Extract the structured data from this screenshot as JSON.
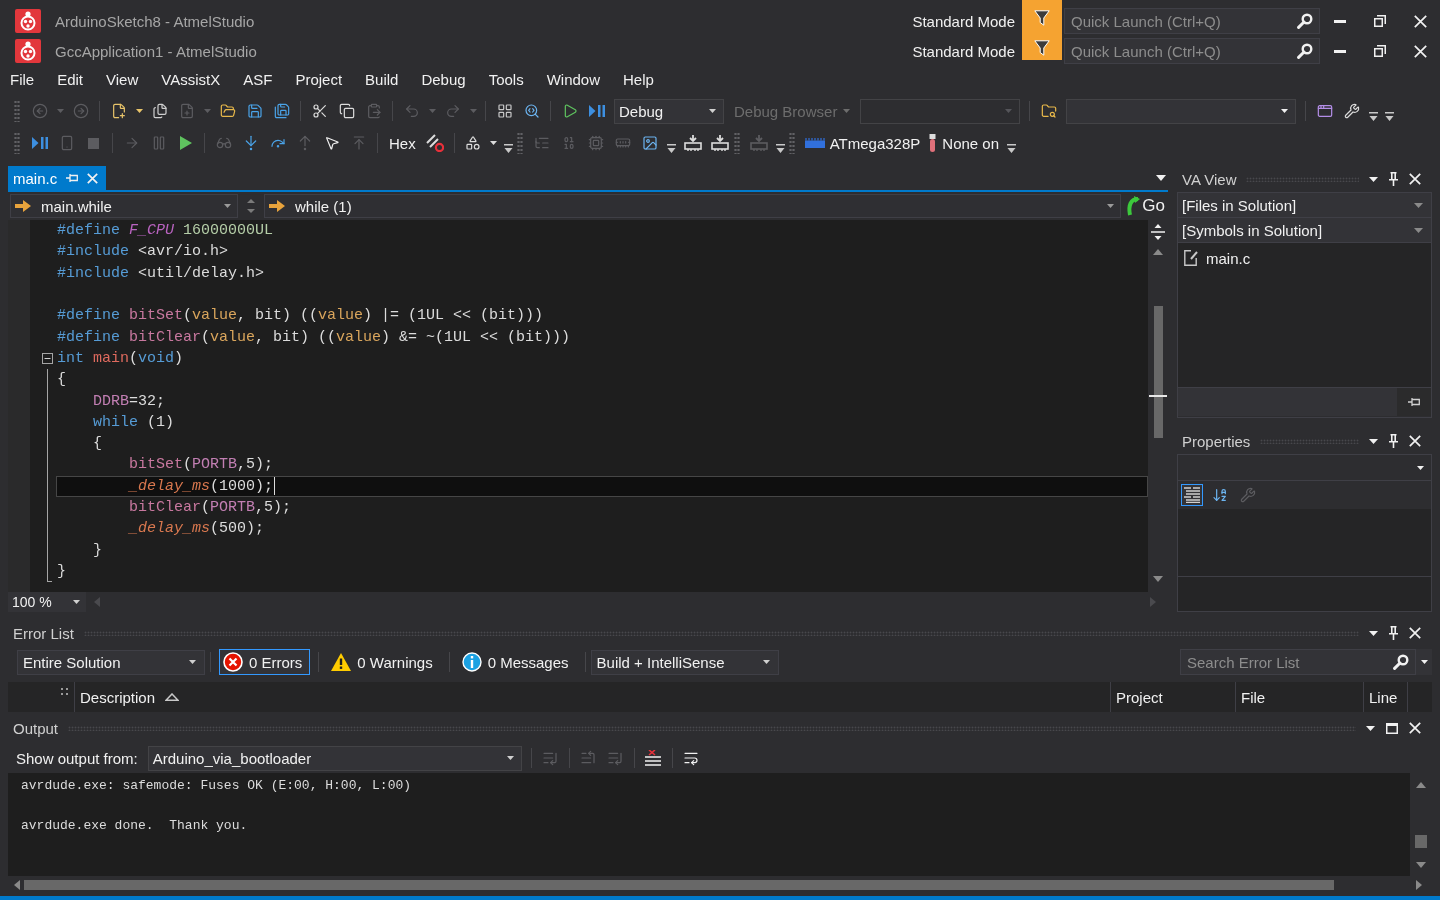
{
  "windows": [
    {
      "title": "ArduinoSketch8 - AtmelStudio",
      "mode": "Standard Mode",
      "quick_launch": {
        "placeholder": "Quick Launch (Ctrl+Q)"
      }
    },
    {
      "title": "GccApplication1 - AtmelStudio",
      "mode": "Standard Mode",
      "quick_launch": {
        "placeholder": "Quick Launch (Ctrl+Q)"
      }
    }
  ],
  "menu": [
    "File",
    "Edit",
    "View",
    "VAssistX",
    "ASF",
    "Project",
    "Build",
    "Debug",
    "Tools",
    "Window",
    "Help"
  ],
  "toolbar_1": {
    "buttons": [
      {
        "disabled": true
      },
      {
        "disabled": true
      },
      {
        "disabled": false
      },
      {
        "disabled": false
      },
      {
        "disabled": true
      },
      {
        "disabled": false
      },
      {
        "disabled": false
      },
      {
        "disabled": false
      },
      {
        "disabled": false
      },
      {
        "disabled": false
      },
      {
        "disabled": true
      },
      {
        "disabled": true
      },
      {
        "disabled": true
      },
      {
        "disabled": false
      },
      {
        "disabled": false
      },
      {
        "disabled": false
      },
      {
        "disabled": false
      },
      {
        "disabled": false
      },
      {
        "disabled": false
      },
      {
        "disabled": false
      }
    ],
    "configuration": "Debug",
    "browser": {
      "label": "Debug Browser",
      "disabled": true
    },
    "target": {
      "disabled": true
    }
  },
  "toolbar_2": {
    "buttons": [
      {
        "disabled": false
      },
      {
        "disabled": true
      },
      {
        "disabled": true
      },
      {
        "disabled": true
      },
      {
        "disabled": true
      },
      {
        "disabled": false
      },
      {
        "disabled": true
      },
      {
        "disabled": false
      },
      {
        "disabled": false
      },
      {
        "disabled": true
      },
      {
        "disabled": false
      },
      {
        "disabled": true
      },
      {
        "disabled": false
      },
      {
        "disabled": false
      },
      {
        "disabled": true
      },
      {
        "disabled": true
      },
      {
        "disabled": true
      },
      {
        "disabled": true
      },
      {
        "disabled": false
      },
      {
        "disabled": false
      },
      {
        "disabled": false
      },
      {
        "disabled": true
      }
    ],
    "hex": "Hex",
    "device": "ATmega328P",
    "tool": "None on"
  },
  "editor": {
    "tabs": [
      {
        "label": "main.c",
        "selected": true
      }
    ],
    "scope": "main.while",
    "member": "while (1)",
    "go": "Go",
    "zoom": "100 %",
    "lines": [
      {
        "tokens": [
          {
            "kind": "directive",
            "text": "#define"
          },
          {
            "kind": "macro",
            "text": " F_CPU"
          },
          {
            "kind": "number",
            "text": " 16000000UL"
          }
        ],
        "current": false
      },
      {
        "tokens": [
          {
            "kind": "directive",
            "text": "#include"
          },
          {
            "kind": "plain",
            "text": " <avr/io.h>"
          }
        ],
        "current": false
      },
      {
        "tokens": [
          {
            "kind": "directive",
            "text": "#include"
          },
          {
            "kind": "plain",
            "text": " <util/delay.h>"
          }
        ],
        "current": false
      },
      {
        "current": false
      },
      {
        "tokens": [
          {
            "kind": "directive",
            "text": "#define"
          },
          {
            "kind": "macro_function",
            "text": " bitSet"
          },
          {
            "kind": "plain",
            "text": "("
          },
          {
            "kind": "parameter",
            "text": "value"
          },
          {
            "kind": "plain",
            "text": ", bit) (("
          },
          {
            "kind": "parameter",
            "text": "value"
          },
          {
            "kind": "plain",
            "text": ") |= (1UL << (bit)))"
          }
        ],
        "current": false
      },
      {
        "tokens": [
          {
            "kind": "directive",
            "text": "#define"
          },
          {
            "kind": "macro_function",
            "text": " bitClear"
          },
          {
            "kind": "plain",
            "text": "("
          },
          {
            "kind": "parameter",
            "text": "value"
          },
          {
            "kind": "plain",
            "text": ", bit) (("
          },
          {
            "kind": "parameter",
            "text": "value"
          },
          {
            "kind": "plain",
            "text": ") &= ~(1UL << (bit)))"
          }
        ],
        "current": false
      },
      {
        "tokens": [
          {
            "kind": "keyword",
            "text": "int"
          },
          {
            "kind": "function",
            "text": " main"
          },
          {
            "kind": "plain",
            "text": "("
          },
          {
            "kind": "keyword",
            "text": "void"
          },
          {
            "kind": "plain",
            "text": ")"
          }
        ],
        "current": false,
        "expanded": true,
        "children": [
          {
            "tokens": [
              {
                "kind": "plain",
                "text": "{"
              }
            ],
            "current": false
          },
          {
            "tokens": [
              {
                "kind": "register",
                "text": "    DDRB"
              },
              {
                "kind": "plain",
                "text": "=32;"
              }
            ],
            "current": false
          },
          {
            "tokens": [
              {
                "kind": "keyword",
                "text": "    while"
              },
              {
                "kind": "plain",
                "text": " (1)"
              }
            ],
            "current": false
          },
          {
            "tokens": [
              {
                "kind": "plain",
                "text": "    {"
              }
            ],
            "current": false
          },
          {
            "tokens": [
              {
                "kind": "macro_function",
                "text": "        bitSet"
              },
              {
                "kind": "plain",
                "text": "("
              },
              {
                "kind": "register",
                "text": "PORTB"
              },
              {
                "kind": "plain",
                "text": ",5);"
              }
            ],
            "current": false
          },
          {
            "tokens": [
              {
                "kind": "italic_function",
                "text": "        _delay_ms"
              },
              {
                "kind": "plain",
                "text": "(1000);"
              }
            ],
            "current": true
          },
          {
            "tokens": [
              {
                "kind": "macro_function",
                "text": "        bitClear"
              },
              {
                "kind": "plain",
                "text": "("
              },
              {
                "kind": "register",
                "text": "PORTB"
              },
              {
                "kind": "plain",
                "text": ",5);"
              }
            ],
            "current": false
          },
          {
            "tokens": [
              {
                "kind": "italic_function",
                "text": "        _delay_ms"
              },
              {
                "kind": "plain",
                "text": "(500);"
              }
            ],
            "current": false
          },
          {
            "tokens": [
              {
                "kind": "plain",
                "text": "    }"
              }
            ],
            "current": false
          },
          {
            "tokens": [
              {
                "kind": "plain",
                "text": "}"
              }
            ],
            "current": false
          }
        ]
      }
    ]
  },
  "va_view": {
    "title": "VA View",
    "files": "[Files in Solution]",
    "symbols": "[Symbols in Solution]",
    "items": [
      "main.c"
    ]
  },
  "properties": {
    "title": "Properties",
    "view_buttons": [
      {
        "selected": true,
        "disabled": false
      },
      {
        "selected": false,
        "disabled": false
      },
      {
        "selected": false,
        "disabled": true
      }
    ]
  },
  "error_list": {
    "title": "Error List",
    "scope": "Entire Solution",
    "filters": [
      {
        "kind": "error",
        "label": "0 Errors",
        "selected": true
      },
      {
        "kind": "warning",
        "label": "0 Warnings",
        "selected": false
      },
      {
        "kind": "message",
        "label": "0 Messages",
        "selected": false
      }
    ],
    "source": "Build + IntelliSense",
    "search": {
      "placeholder": "Search Error List"
    },
    "columns": [
      "Description",
      "Project",
      "File",
      "Line"
    ]
  },
  "output": {
    "title": "Output",
    "show_from_label": "Show output from:",
    "source": "Arduino_via_bootloader",
    "buttons": [
      {
        "disabled": true
      },
      {
        "disabled": true
      },
      {
        "disabled": true
      },
      {
        "disabled": false
      },
      {
        "disabled": false
      }
    ],
    "text": "avrdude.exe: safemode: Fuses OK (E:00, H:00, L:00)\n\navrdude.exe done.  Thank you."
  }
}
